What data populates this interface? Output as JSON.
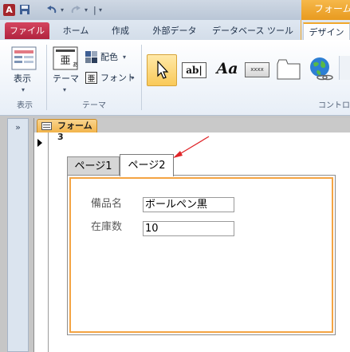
{
  "title_bar": {
    "logo_letter": "A",
    "contextual_title": "フォーム"
  },
  "ribbon_tabs": [
    "ファイル",
    "ホーム",
    "作成",
    "外部データ",
    "データベース ツール",
    "デザイン"
  ],
  "ribbon": {
    "view": {
      "label": "表示",
      "group_label": "表示"
    },
    "theme": {
      "theme_label": "テーマ",
      "colors_label": "配色",
      "fonts_label": "フォント",
      "group_label": "テーマ"
    },
    "controls": {
      "textbox_glyph": "ab|",
      "label_glyph": "Aa",
      "button_glyph": "xxxx",
      "group_label": "コントロ"
    }
  },
  "navigation": {
    "toggle": "»"
  },
  "document": {
    "tab_label": "フォーム3"
  },
  "tab_control": {
    "pages": [
      "ページ1",
      "ページ2"
    ],
    "active_page": 1
  },
  "form_fields": [
    {
      "label": "備品名",
      "value": "ボールペン黒"
    },
    {
      "label": "在庫数",
      "value": "10"
    }
  ],
  "colors": {
    "accent_orange": "#f4a443",
    "file_tab": "#c02a47",
    "annotation_arrow": "#e0262a"
  }
}
